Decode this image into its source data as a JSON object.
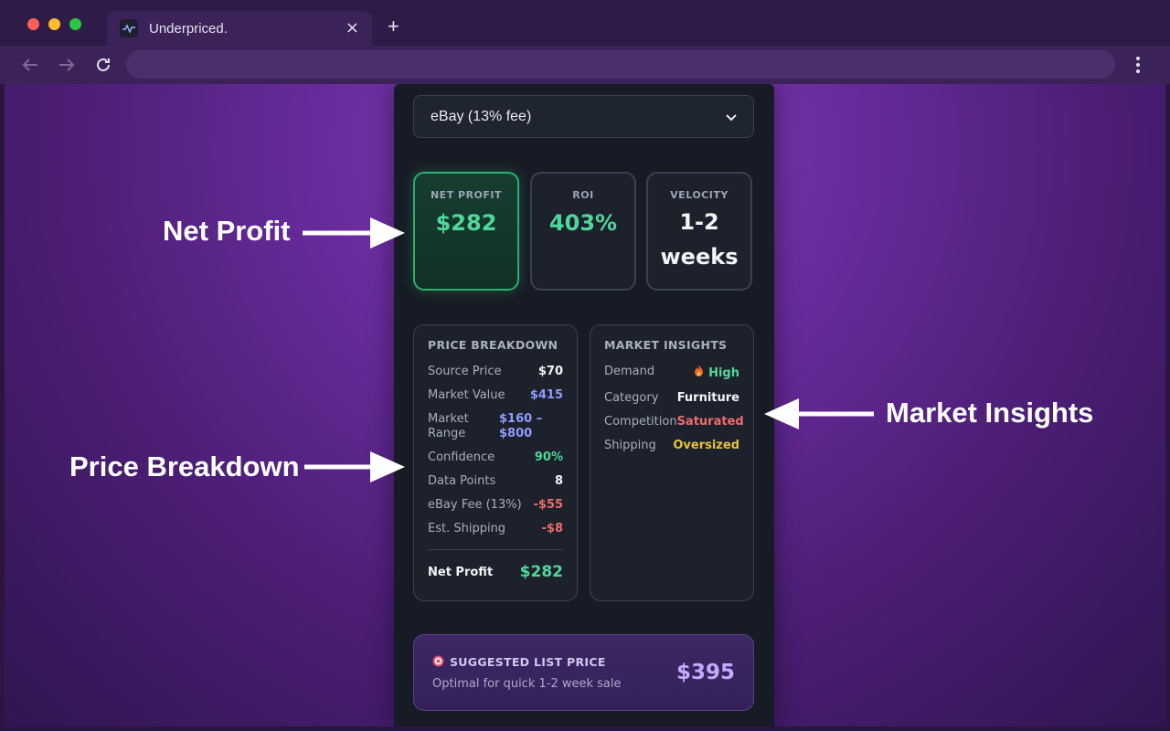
{
  "browser": {
    "tab_title": "Underpriced.",
    "tab_close_glyph": "×",
    "new_tab_glyph": "+"
  },
  "marketplace": {
    "selected": "eBay (13% fee)"
  },
  "stats": [
    {
      "label": "NET PROFIT",
      "value": "$282"
    },
    {
      "label": "ROI",
      "value": "403%"
    },
    {
      "label": "VELOCITY",
      "value_line1": "1-2",
      "value_line2": "weeks"
    }
  ],
  "price_breakdown": {
    "title": "PRICE BREAKDOWN",
    "rows": [
      {
        "label": "Source Price",
        "value": "$70",
        "color": "#f2f4f8"
      },
      {
        "label": "Market Value",
        "value": "$415",
        "color": "#8f9cff"
      },
      {
        "label_line1": "Market",
        "label_line2": "Range",
        "value_line1": "$160 –",
        "value_line2": "$800",
        "color": "#8f9cff"
      },
      {
        "label": "Confidence",
        "value": "90%",
        "color": "#4fd79a"
      },
      {
        "label": "Data Points",
        "value": "8",
        "color": "#f2f4f8"
      },
      {
        "label": "eBay Fee (13%)",
        "value": "-$55",
        "color": "#ef6b6b"
      },
      {
        "label": "Est. Shipping",
        "value": "-$8",
        "color": "#ef6b6b"
      }
    ],
    "total_label": "Net Profit",
    "total_value": "$282"
  },
  "market_insights": {
    "title": "MARKET INSIGHTS",
    "rows": [
      {
        "label": "Demand",
        "value": "High",
        "icon": "fire-icon",
        "color": "#4fd79a"
      },
      {
        "label": "Category",
        "value": "Furniture",
        "color": "#f2f4f8"
      },
      {
        "label": "Competition",
        "value": "Saturated",
        "color": "#ef6b6b"
      },
      {
        "label": "Shipping",
        "value": "Oversized",
        "color": "#e8c23a"
      }
    ]
  },
  "suggested": {
    "title": "SUGGESTED LIST PRICE",
    "subtitle": "Optimal for quick 1-2 week sale",
    "price": "$395"
  },
  "annotations": {
    "net_profit": "Net Profit",
    "market_insights": "Market Insights",
    "price_breakdown": "Price Breakdown"
  },
  "colors": {
    "accent_green": "#4fd79a",
    "accent_purple": "#c6a8ff",
    "panel_bg": "#171b25"
  }
}
